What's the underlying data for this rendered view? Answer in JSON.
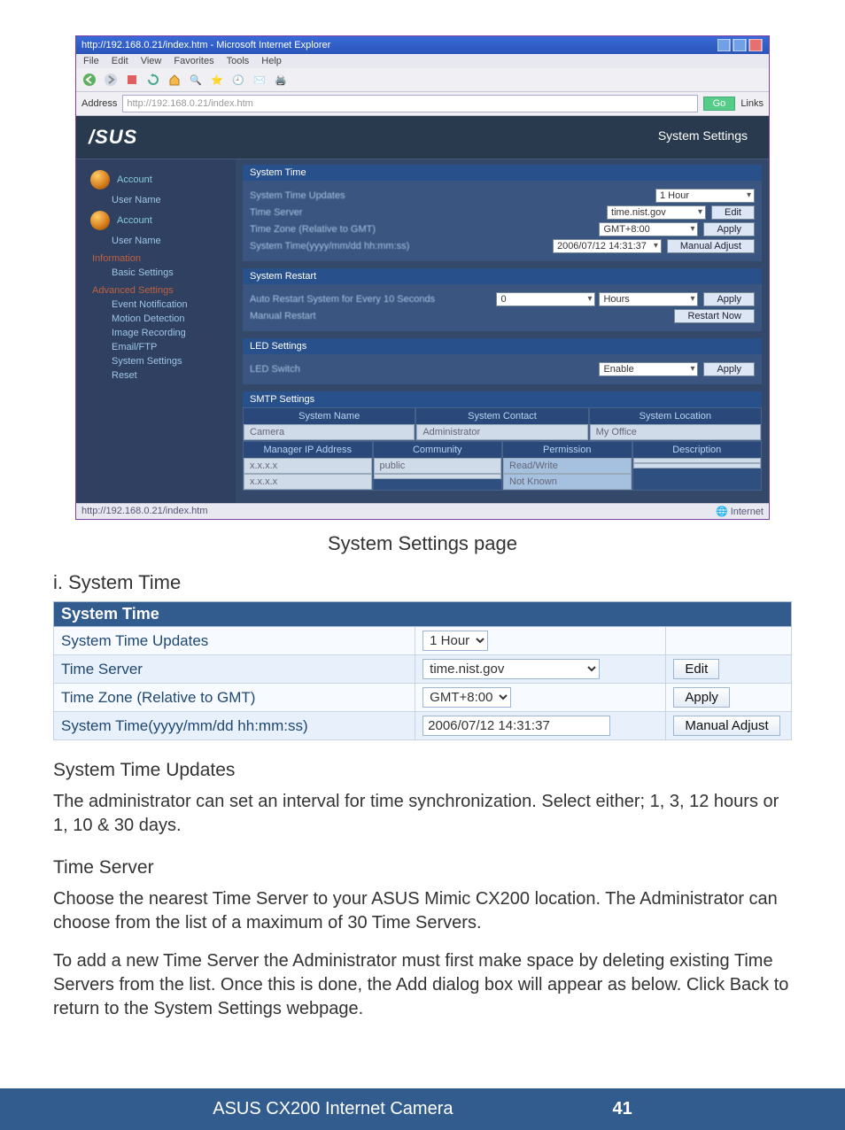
{
  "browser": {
    "title": "http://192.168.0.21/index.htm - Microsoft Internet Explorer",
    "menus": [
      "File",
      "Edit",
      "View",
      "Favorites",
      "Tools",
      "Help"
    ],
    "address_label": "Address",
    "address_value": "http://192.168.0.21/index.htm",
    "go_label": "Go",
    "links_label": "Links"
  },
  "app": {
    "logo": "/SUS",
    "settings_header": "System Settings",
    "sidebar": {
      "items": [
        {
          "label": "Account"
        },
        {
          "sub": "User Name"
        },
        {
          "label": "Account"
        },
        {
          "sub": "User Name"
        }
      ],
      "groups": [
        {
          "head": "Information",
          "items": [
            "Basic Settings"
          ]
        },
        {
          "head": "Advanced Settings",
          "items": [
            "Event Notification",
            "Motion Detection",
            "Image Recording",
            "Email/FTP",
            "System Settings",
            "Reset"
          ]
        }
      ]
    },
    "panels": {
      "system_time": {
        "title": "System Time",
        "rows": [
          {
            "lbl": "System Time Updates",
            "val": "1 Hour"
          },
          {
            "lbl": "Time Server",
            "val": "time.nist.gov",
            "btn": "Edit"
          },
          {
            "lbl": "Time Zone (Relative to GMT)",
            "val": "GMT+8:00",
            "btn": "Apply"
          },
          {
            "lbl": "System Time(yyyy/mm/dd hh:mm:ss)",
            "val": "2006/07/12 14:31:37",
            "btn": "Manual Adjust"
          }
        ]
      },
      "system_restart": {
        "title": "System Restart",
        "lbl": "Auto Restart System for Every 10 Seconds",
        "sel": "0",
        "sel2": "Hours",
        "btn": "Apply",
        "btn2": "Restart Now",
        "lbl2": "Manual Restart"
      },
      "led": {
        "title": "LED Settings",
        "lbl": "LED Switch",
        "sel": "Enable",
        "btn": "Apply"
      },
      "smtp": {
        "title": "SMTP Settings",
        "cols": [
          "System Name",
          "System Contact",
          "System Location"
        ],
        "row1": [
          "Camera",
          "Administrator",
          "My Office"
        ],
        "subcols": [
          "Manager IP Address",
          "Community",
          "Permission",
          "Description"
        ],
        "row2": [
          "x.x.x.x",
          "public",
          "Read/Write",
          ""
        ],
        "row3": [
          "x.x.x.x",
          "",
          "Not Known",
          ""
        ]
      }
    }
  },
  "caption": "System Settings page",
  "section_i": "i. System Time",
  "table": {
    "title": "System Time",
    "rows": [
      {
        "label": "System Time Updates",
        "select": "1 Hour"
      },
      {
        "label": "Time Server",
        "input": "time.nist.gov",
        "button": "Edit"
      },
      {
        "label": "Time Zone (Relative to GMT)",
        "select": "GMT+8:00",
        "button": "Apply"
      },
      {
        "label": "System Time(yyyy/mm/dd hh:mm:ss)",
        "input": "2006/07/12 14:31:37",
        "button": "Manual Adjust"
      }
    ]
  },
  "para": {
    "h_updates": "System Time Updates",
    "p_updates": "The administrator can set an interval for time synchronization.  Select either; 1, 3, 12 hours or 1, 10 & 30 days.",
    "h_server": "Time Server",
    "p_server1": "Choose the nearest Time Server to your ASUS Mimic CX200 location.  The Administrator can choose from the list of a maximum of 30 Time Servers.",
    "p_server2": "To add a new Time Server the Administrator must first make space by deleting existing Time Servers from the list.  Once this is done, the Add dialog box will appear as below.  Click Back to return to the System Settings webpage."
  },
  "footer": {
    "text": "ASUS CX200 Internet Camera",
    "page": "41"
  }
}
